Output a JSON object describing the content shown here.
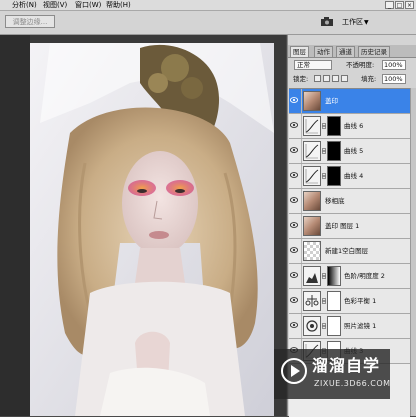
{
  "menubar": {
    "items": [
      "分析(N)",
      "视图(V)",
      "窗口(W)",
      "帮助(H)"
    ],
    "window_buttons": [
      "_",
      "□",
      "×"
    ]
  },
  "options_bar": {
    "refine_edge_label": "调整边缘...",
    "workspace_label": "工作区",
    "workspace_arrow": "▼"
  },
  "panel": {
    "tabs": [
      "图层",
      "动作",
      "通道",
      "历史记录"
    ],
    "active_tab": "图层",
    "blend_mode": "正常",
    "opacity_label": "不透明度:",
    "opacity_value": "100%",
    "lock_label": "锁定:",
    "fill_label": "填充:",
    "fill_value": "100%",
    "layers": [
      {
        "name": "盖印",
        "selected": true,
        "kind": "pixel"
      },
      {
        "name": "曲线 6",
        "selected": false,
        "kind": "curves-dark"
      },
      {
        "name": "曲线 5",
        "selected": false,
        "kind": "curves-dark"
      },
      {
        "name": "曲线 4",
        "selected": false,
        "kind": "curves-dark"
      },
      {
        "name": "移相底",
        "selected": false,
        "kind": "pixel"
      },
      {
        "name": "盖印 图层 1",
        "selected": false,
        "kind": "pixel"
      },
      {
        "name": "新建1空白图层",
        "selected": false,
        "kind": "blank"
      },
      {
        "name": "色阶/明度度 2",
        "selected": false,
        "kind": "levels"
      },
      {
        "name": "色彩平衡 1",
        "selected": false,
        "kind": "balance"
      },
      {
        "name": "照片滤镜 1",
        "selected": false,
        "kind": "filter"
      },
      {
        "name": "曲线 3",
        "selected": false,
        "kind": "curves-light"
      }
    ]
  },
  "watermark": {
    "name_cn": "溜溜自学",
    "url": "ZIXUE.3D66.COM"
  },
  "colors": {
    "selection": "#3a83e8",
    "menubar": "#dcdcdc",
    "panel": "#d4d4d4"
  }
}
